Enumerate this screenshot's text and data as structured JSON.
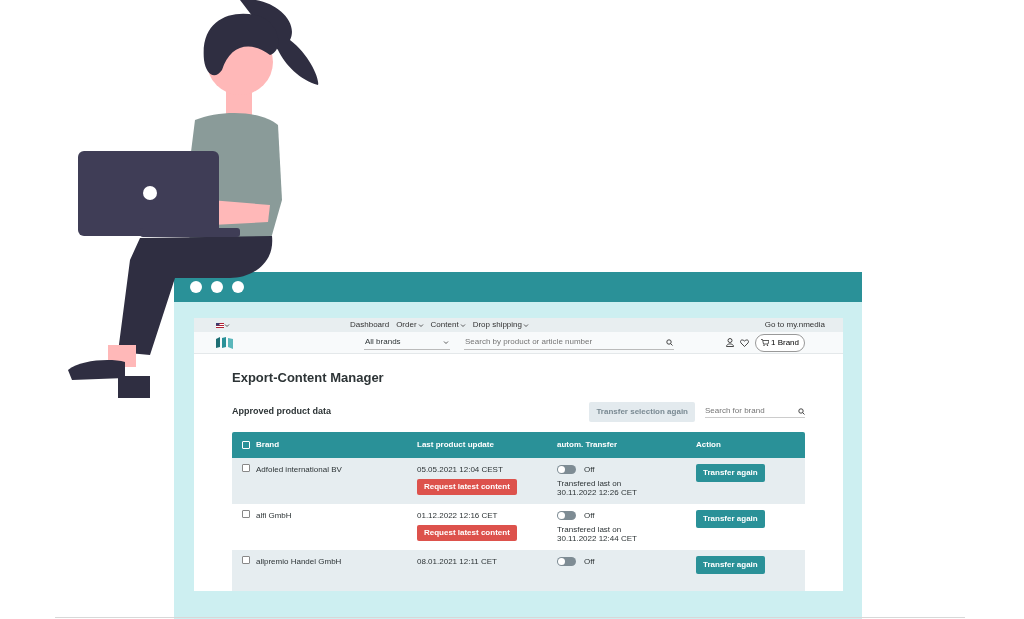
{
  "topbar": {
    "nav": [
      {
        "label": "Dashboard",
        "dropdown": false
      },
      {
        "label": "Order",
        "dropdown": true
      },
      {
        "label": "Content",
        "dropdown": true
      },
      {
        "label": "Drop shipping",
        "dropdown": true
      }
    ],
    "link": "Go to my.nmedia"
  },
  "header": {
    "brand_select": "All brands",
    "search": {
      "placeholder": "Search by product or article number"
    },
    "cart": "1 Brand"
  },
  "page": {
    "title": "Export-Content Manager",
    "subtitle": "Approved product data",
    "transfer_button": {
      "label": "Transfer selection again",
      "disabled": true
    },
    "brand_search": {
      "placeholder": "Search for brand"
    }
  },
  "table": {
    "columns": [
      "Brand",
      "Last product update",
      "autom. Transfer",
      "Action"
    ],
    "header_checked": false,
    "rows": [
      {
        "brand": "Adfoled international BV",
        "checked": false,
        "updated": "05.05.2021 12:04 CEST",
        "request": "Request latest content",
        "auto": false,
        "auto_label": "Off",
        "transfer_note": "Transfered last on",
        "transfer_time": "30.11.2022 12:26 CET",
        "action": "Transfer again"
      },
      {
        "brand": "alfi GmbH",
        "checked": false,
        "updated": "01.12.2022 12:16 CET",
        "request": "Request latest content",
        "auto": false,
        "auto_label": "Off",
        "transfer_note": "Transfered last on",
        "transfer_time": "30.11.2022 12:44 CET",
        "action": "Transfer again"
      },
      {
        "brand": "allpremio Handel GmbH",
        "checked": false,
        "updated": "08.01.2021 12:11 CET",
        "auto": false,
        "auto_label": "Off",
        "action": "Transfer again"
      }
    ]
  }
}
